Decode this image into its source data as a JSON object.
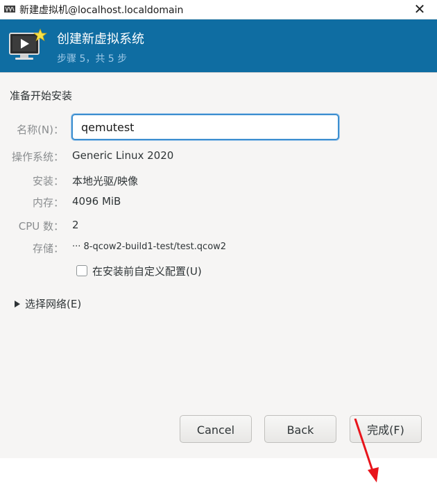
{
  "window": {
    "title": "新建虚拟机@localhost.localdomain",
    "icons": {
      "app": "vm-app-icon",
      "close": "close-icon"
    }
  },
  "header": {
    "title": "创建新虚拟系统",
    "step": "步骤 5，共 5 步",
    "icon": "monitor-star-icon"
  },
  "summary": {
    "heading": "准备开始安装",
    "name": {
      "label": "名称(N)：",
      "value": "qemutest"
    },
    "rows": [
      {
        "label": "操作系统：",
        "value": "Generic Linux 2020"
      },
      {
        "label": "安装：",
        "value": "本地光驱/映像"
      },
      {
        "label": "内存：",
        "value": "4096 MiB"
      },
      {
        "label": "CPU 数：",
        "value": "2"
      },
      {
        "label": "存储：",
        "value": "··· 8-qcow2-build1-test/test.qcow2"
      }
    ],
    "customize": {
      "label": "在安装前自定义配置(U)",
      "checked": false
    }
  },
  "network": {
    "label": "选择网络(E)",
    "expanded": false
  },
  "buttons": {
    "cancel": "Cancel",
    "back": "Back",
    "finish": "完成(F)"
  },
  "colors": {
    "banner": "#0f6da2",
    "focus": "#3d8fd0",
    "annotation_arrow": "#e8141b"
  }
}
